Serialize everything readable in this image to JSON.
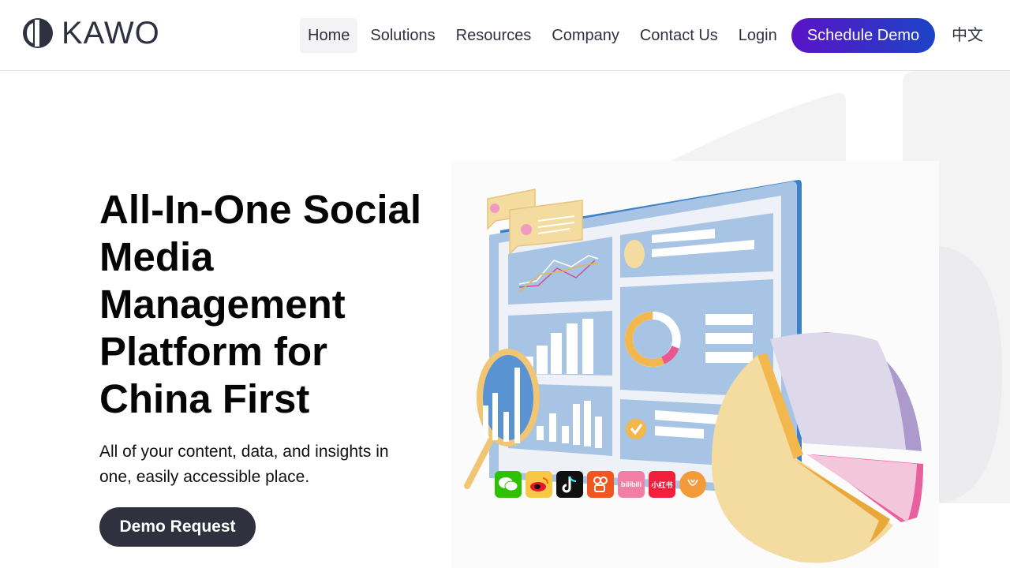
{
  "header": {
    "logo_text": "KAWO",
    "nav": [
      {
        "label": "Home",
        "active": true
      },
      {
        "label": "Solutions",
        "active": false
      },
      {
        "label": "Resources",
        "active": false
      },
      {
        "label": "Company",
        "active": false
      },
      {
        "label": "Contact Us",
        "active": false
      },
      {
        "label": "Login",
        "active": false
      }
    ],
    "cta_label": "Schedule Demo",
    "language_label": "中文"
  },
  "hero": {
    "title": "All-In-One Social Media Management Platform for China First",
    "subtitle": "All of your content, data, and insights in one, easily accessible place.",
    "button_label": "Demo Request"
  },
  "illustration": {
    "social_icons": [
      {
        "name": "wechat-icon",
        "color": "#2dc100",
        "glyph": ""
      },
      {
        "name": "weibo-icon",
        "color": "#f7c846",
        "glyph": ""
      },
      {
        "name": "douyin-icon",
        "color": "#111111",
        "glyph": ""
      },
      {
        "name": "kuaishou-icon",
        "color": "#f0561f",
        "glyph": ""
      },
      {
        "name": "bilibili-icon",
        "color": "#f07fa3",
        "glyph": "bilibili"
      },
      {
        "name": "xiaohongshu-icon",
        "color": "#f2203c",
        "glyph": "小红书"
      },
      {
        "name": "toutiao-icon",
        "color": "#f39a3b",
        "glyph": ""
      }
    ]
  },
  "colors": {
    "cta_gradient_start": "#5b12c8",
    "cta_gradient_end": "#1b44c6",
    "demo_button": "#30303f",
    "dashboard_blue": "#a8c4e4",
    "pie_yellow": "#f4dba0",
    "pie_purple": "#ddd8ea",
    "pie_pink": "#f3c6dc"
  }
}
